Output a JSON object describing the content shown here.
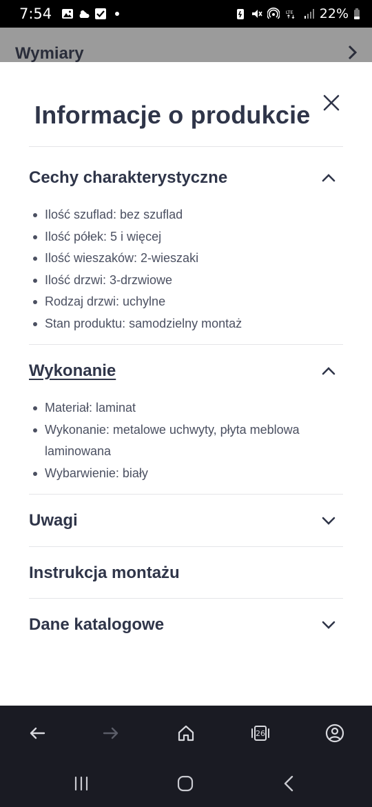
{
  "status_bar": {
    "time": "7:54",
    "network": "LTE",
    "battery": "22%"
  },
  "background_page": {
    "section_title": "Wymiary"
  },
  "sheet": {
    "title": "Informacje o produkcie",
    "sections": [
      {
        "title": "Cechy charakterystyczne",
        "expanded": true,
        "items": [
          "Ilość szuflad: bez szuflad",
          "Ilość półek: 5 i więcej",
          "Ilość wieszaków: 2-wieszaki",
          "Ilość drzwi: 3-drzwiowe",
          "Rodzaj drzwi: uchylne",
          "Stan produktu: samodzielny montaż"
        ]
      },
      {
        "title": "Wykonanie",
        "expanded": true,
        "items": [
          "Materiał: laminat",
          "Wykonanie: metalowe uchwyty, płyta meblowa laminowana",
          "Wybarwienie: biały"
        ]
      },
      {
        "title": "Uwagi",
        "expanded": false
      },
      {
        "title": "Instrukcja montażu"
      },
      {
        "title": "Dane katalogowe",
        "expanded": false
      }
    ]
  },
  "browser_bar": {
    "tabs_count": "26"
  },
  "colors": {
    "text": "#2f3549",
    "body_text": "#4b5061",
    "divider": "#e4e5e8",
    "dark_bar": "#1a1b23",
    "dim_overlay": "#9b9b9b"
  }
}
